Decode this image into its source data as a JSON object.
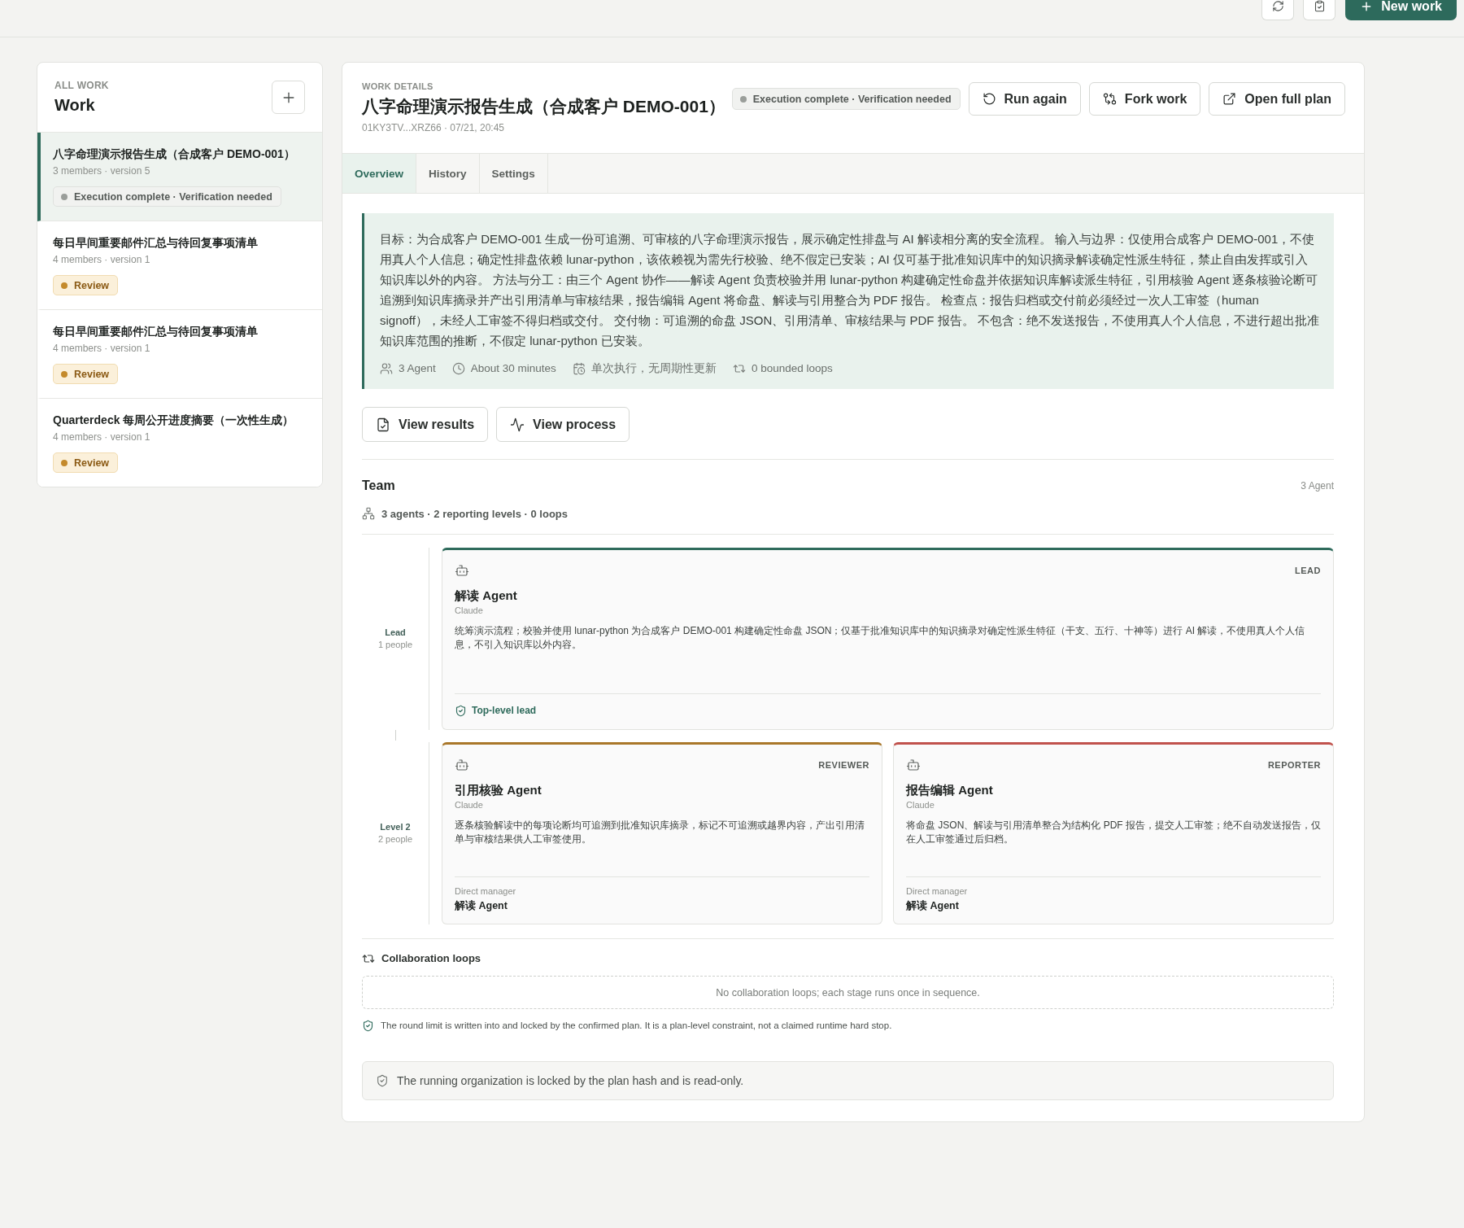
{
  "topbar": {
    "new_button": "New work"
  },
  "sidebar": {
    "eyebrow": "ALL WORK",
    "title": "Work",
    "items": [
      {
        "title": "八字命理演示报告生成（合成客户 DEMO-001）",
        "meta": "3 members · version 5",
        "status": {
          "kind": "neutral",
          "label": "Execution complete · Verification needed"
        },
        "selected": true
      },
      {
        "title": "每日早间重要邮件汇总与待回复事项清单",
        "meta": "4 members · version 1",
        "status": {
          "kind": "review",
          "label": "Review"
        },
        "selected": false
      },
      {
        "title": "每日早间重要邮件汇总与待回复事项清单",
        "meta": "4 members · version 1",
        "status": {
          "kind": "review",
          "label": "Review"
        },
        "selected": false
      },
      {
        "title": "Quarterdeck 每周公开进度摘要（一次性生成）",
        "meta": "4 members · version 1",
        "status": {
          "kind": "review",
          "label": "Review"
        },
        "selected": false
      }
    ]
  },
  "work": {
    "eyebrow": "WORK DETAILS",
    "title": "八字命理演示报告生成（合成客户 DEMO-001）",
    "id_line": "01KY3TV...XRZ66 · 07/21, 20:45",
    "status": {
      "kind": "neutral",
      "label": "Execution complete · Verification needed"
    },
    "actions": [
      {
        "kind": "rerun",
        "label": "Run again"
      },
      {
        "kind": "fork",
        "label": "Fork work"
      },
      {
        "kind": "open",
        "label": "Open full plan"
      }
    ]
  },
  "tabs": [
    {
      "label": "Overview",
      "selected": true
    },
    {
      "label": "History",
      "selected": false
    },
    {
      "label": "Settings",
      "selected": false
    }
  ],
  "goal": {
    "text": "目标：为合成客户 DEMO-001 生成一份可追溯、可审核的八字命理演示报告，展示确定性排盘与 AI 解读相分离的安全流程。 输入与边界：仅使用合成客户 DEMO-001，不使用真人个人信息；确定性排盘依赖 lunar-python，该依赖视为需先行校验、绝不假定已安装；AI 仅可基于批准知识库中的知识摘录解读确定性派生特征，禁止自由发挥或引入知识库以外的内容。 方法与分工：由三个 Agent 协作——解读 Agent 负责校验并用 lunar-python 构建确定性命盘并依据知识库解读派生特征，引用核验 Agent 逐条核验论断可追溯到知识库摘录并产出引用清单与审核结果，报告编辑 Agent 将命盘、解读与引用整合为 PDF 报告。 检查点：报告归档或交付前必须经过一次人工审签（human signoff），未经人工审签不得归档或交付。 交付物：可追溯的命盘 JSON、引用清单、审核结果与 PDF 报告。 不包含：绝不发送报告，不使用真人个人信息，不进行超出批准知识库范围的推断，不假定 lunar-python 已安装。",
    "facts": [
      {
        "kind": "agents",
        "text": "3 Agent"
      },
      {
        "kind": "duration",
        "text": "About 30 minutes"
      },
      {
        "kind": "schedule",
        "text": "单次执行，无周期性更新"
      },
      {
        "kind": "loops",
        "text": "0 bounded loops"
      }
    ]
  },
  "views": [
    {
      "kind": "results",
      "label": "View results"
    },
    {
      "kind": "process",
      "label": "View process"
    }
  ],
  "team": {
    "title": "Team",
    "count": "3 Agent",
    "summary": "3 agents · 2 reporting levels · 0 loops",
    "levels": [
      {
        "name": "Lead",
        "people": "1 people",
        "agents": [
          {
            "name": "解读 Agent",
            "model": "Claude",
            "role": "LEAD",
            "color": "#2f6b5c",
            "description": "统筹演示流程；校验并使用 lunar-python 为合成客户 DEMO-001 构建确定性命盘 JSON；仅基于批准知识库中的知识摘录对确定性派生特征（干支、五行、十神等）进行 AI 解读，不使用真人个人信息，不引入知识库以外内容。",
            "footer": {
              "kind": "top",
              "label": "Top-level lead"
            }
          }
        ]
      },
      {
        "name": "Level 2",
        "people": "2 people",
        "agents": [
          {
            "name": "引用核验 Agent",
            "model": "Claude",
            "role": "REVIEWER",
            "color": "#a9772a",
            "description": "逐条核验解读中的每项论断均可追溯到批准知识库摘录，标记不可追溯或越界内容，产出引用清单与审核结果供人工审签使用。",
            "footer": {
              "kind": "manager",
              "label": "Direct manager",
              "value": "解读 Agent"
            }
          },
          {
            "name": "报告编辑 Agent",
            "model": "Claude",
            "role": "REPORTER",
            "color": "#c0524c",
            "description": "将命盘 JSON、解读与引用清单整合为结构化 PDF 报告，提交人工审签；绝不自动发送报告，仅在人工审签通过后归档。",
            "footer": {
              "kind": "manager",
              "label": "Direct manager",
              "value": "解读 Agent"
            }
          }
        ]
      }
    ]
  },
  "loops": {
    "title": "Collaboration loops",
    "empty": "No collaboration loops; each stage runs once in sequence.",
    "note": "The round limit is written into and locked by the confirmed plan. It is a plan-level constraint, not a claimed runtime hard stop."
  },
  "lock_notice": "The running organization is locked by the plan hash and is read-only."
}
